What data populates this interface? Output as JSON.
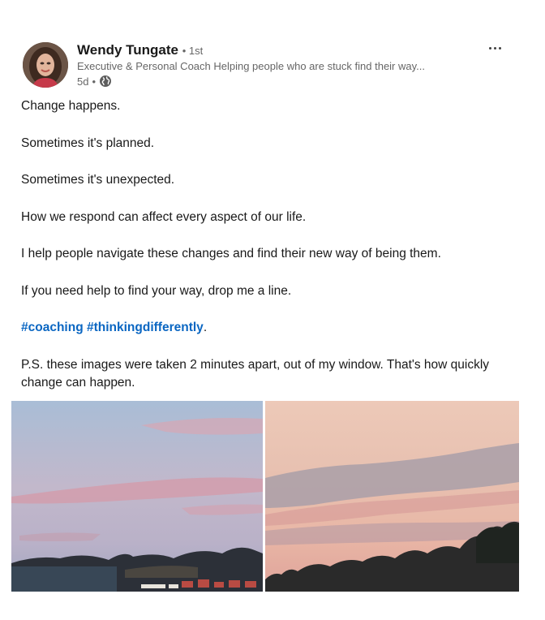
{
  "author": {
    "name": "Wendy Tungate",
    "connection_separator": "•",
    "connection_degree": "1st",
    "headline": "Executive & Personal Coach Helping people who are stuck find their way...",
    "posted_ago": "5d",
    "meta_separator": "•",
    "visibility_icon": "globe-icon",
    "avatar_icon": "profile-photo"
  },
  "menu": {
    "icon": "more-horizontal-icon"
  },
  "post": {
    "paragraphs": [
      "Change happens.",
      "Sometimes it's planned.",
      "Sometimes it's unexpected.",
      "How we respond can affect every aspect of our life.",
      "I help people navigate these changes and find their new way of being them.",
      "If you need help to find your way, drop me a line."
    ],
    "hashtags": [
      "#coaching",
      "#thinkingdifferently"
    ],
    "hashtag_suffix": ".",
    "postscript": "P.S. these images were taken 2 minutes apart, out of my window. That's how quickly change can happen."
  },
  "images": [
    {
      "name": "sunset-photo-1"
    },
    {
      "name": "sunset-photo-2"
    }
  ],
  "colors": {
    "link": "#0a66c2",
    "text": "#191919",
    "secondary": "#666666"
  }
}
